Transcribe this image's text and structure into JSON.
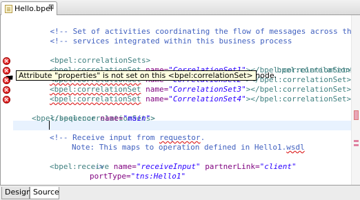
{
  "tab": {
    "title": "Hello.bpel",
    "close_glyph": "⊠",
    "icon": "bpel-file-icon"
  },
  "code": {
    "l1_pre": "<!-- Set of activities coordinating the flow of messages across the",
    "l2_pre": "<!-- services integrated within this business process",
    "l3_pre": "<!-- ================================================================",
    "l4_tag": "<bpel:correlationSets>",
    "l5_tail": "bpel:correlationSet>",
    "set_open": "<bpel:correlationSet",
    "name_attr": "name=",
    "set_close": "></bpel:correlationSet>",
    "sets": [
      "\"CorrelationSet1\"",
      "\"CorrelationSet2\"",
      "\"CorrelationSet3\"",
      "\"CorrelationSet4\""
    ],
    "l10_tag": "</bpel:correlationSets>",
    "l11_open": "<bpel:sequence",
    "l11_val": "\"main\"",
    "l11_close": ">",
    "l13_a": "<!-- Receive input from ",
    "l13_b": "requestor",
    "l13_c": ".",
    "l14_a": "Note: This maps to operation defined in Hello1.",
    "l14_b": "wsdl",
    "l15": "-->",
    "l16_open": "<bpel:receive",
    "l16_name_val": "\"receiveInput\"",
    "l16_partner_attr": "partnerLink=",
    "l16_partner_val": "\"client\"",
    "l17_attr": "portType=",
    "l17_val": "\"tns:Hello1\""
  },
  "tooltip": {
    "text": "Attribute \"properties\" is not set on this <bpel:correlationSet> node."
  },
  "bottom_tabs": {
    "design": "Design",
    "source": "Source",
    "active": "Source"
  },
  "colors": {
    "comment": "#3f5fbf",
    "tag": "#3f7f7f",
    "attribute": "#7f007f",
    "value": "#2a00ff",
    "error": "#d11111",
    "tooltip_bg": "#ffffe1"
  }
}
